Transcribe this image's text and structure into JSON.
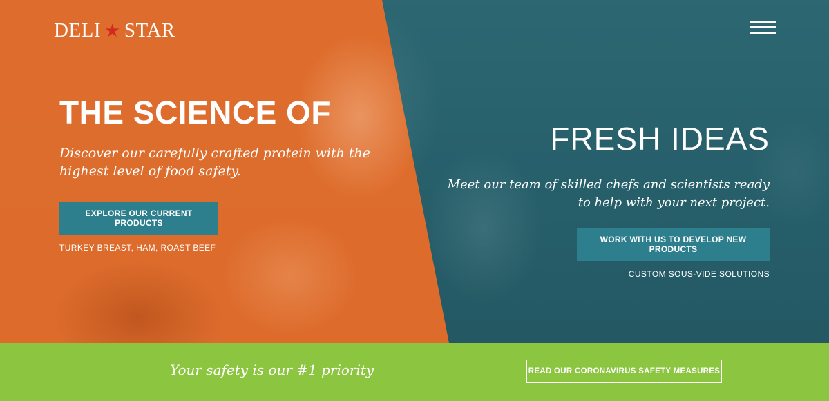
{
  "header": {
    "logo_left": "DELI",
    "logo_right": "STAR",
    "menu_icon": "hamburger-menu-icon"
  },
  "left": {
    "headline": "THE SCIENCE OF",
    "body": "Discover our carefully crafted protein with the highest level of food safety.",
    "button_label": "EXPLORE OUR CURRENT PRODUCTS",
    "subtext": "TURKEY BREAST, HAM, ROAST BEEF"
  },
  "right": {
    "headline": "FRESH IDEAS",
    "body": "Meet our team of skilled chefs and scientists ready to help with your next project.",
    "button_label": "WORK WITH US TO DEVELOP NEW PRODUCTS",
    "subtext": "CUSTOM SOUS-VIDE SOLUTIONS"
  },
  "banner": {
    "text": "Your safety is our #1 priority",
    "button_label": "READ OUR CORONAVIRUS SAFETY MEASURES"
  },
  "colors": {
    "orange": "#ec6e28",
    "teal": "#2d7f8d",
    "green": "#8cc540",
    "star_red": "#d42a1e"
  }
}
